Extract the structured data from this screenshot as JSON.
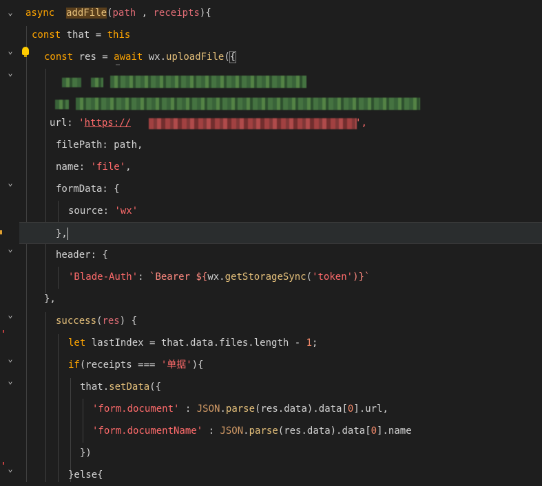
{
  "lines": {
    "l1": {
      "a": "async",
      "b": "addFile",
      "c": "(",
      "d": "path",
      "e": " , ",
      "f": "receipts",
      "g": "){"
    },
    "l2": {
      "a": "const",
      "b": " that = ",
      "c": "this"
    },
    "l3": {
      "a": "const",
      "b": " res = ",
      "c": "await",
      "d": " wx.",
      "e": "uploadFile",
      "f": "(",
      "g": "{"
    },
    "l3_ellipsis": "…",
    "l5": {
      "a": "url: ",
      "b": "'",
      "c": "https://",
      "d": "',"
    },
    "l6": {
      "a": "filePath: path,"
    },
    "l7": {
      "a": "name: ",
      "b": "'file'",
      "c": ","
    },
    "l8": {
      "a": "formData: {"
    },
    "l9": {
      "a": "source: ",
      "b": "'wx'"
    },
    "l10": {
      "a": "},"
    },
    "l11": {
      "a": "header: {"
    },
    "l12": {
      "a": "'Blade-Auth'",
      "b": ": ",
      "c": "`Bearer ${",
      "d": "wx.",
      "e": "getStorageSync",
      "f": "(",
      "g": "'token'",
      "h": ")}`"
    },
    "l13": {
      "a": "},"
    },
    "l14": {
      "a": "success",
      "b": "(",
      "c": "res",
      "d": ") {"
    },
    "l15": {
      "a": "let",
      "b": " lastIndex = that.data.files.length - ",
      "c": "1",
      ";": ";"
    },
    "l16": {
      "a": "if",
      "b": "(receipts === ",
      "c": "'单据'",
      "d": "){"
    },
    "l17": {
      "a": "that.",
      "b": "setData",
      "c": "({"
    },
    "l18": {
      "a": "'form.document'",
      "b": " : ",
      "c": "JSON",
      "d": ".",
      "e": "parse",
      "f": "(res.data).data[",
      "g": "0",
      "h": "].url,"
    },
    "l19": {
      "a": "'form.documentName'",
      "b": " : ",
      "c": "JSON",
      "d": ".",
      "e": "parse",
      "f": "(res.data).data[",
      "g": "0",
      "h": "].name"
    },
    "l20": {
      "a": "})"
    },
    "l21": {
      "a": "}else{"
    }
  },
  "colors": {
    "background": "#1e1e1e",
    "keyword": "#ffa500",
    "string": "#ff6b6b",
    "function": "#e5c07b"
  }
}
